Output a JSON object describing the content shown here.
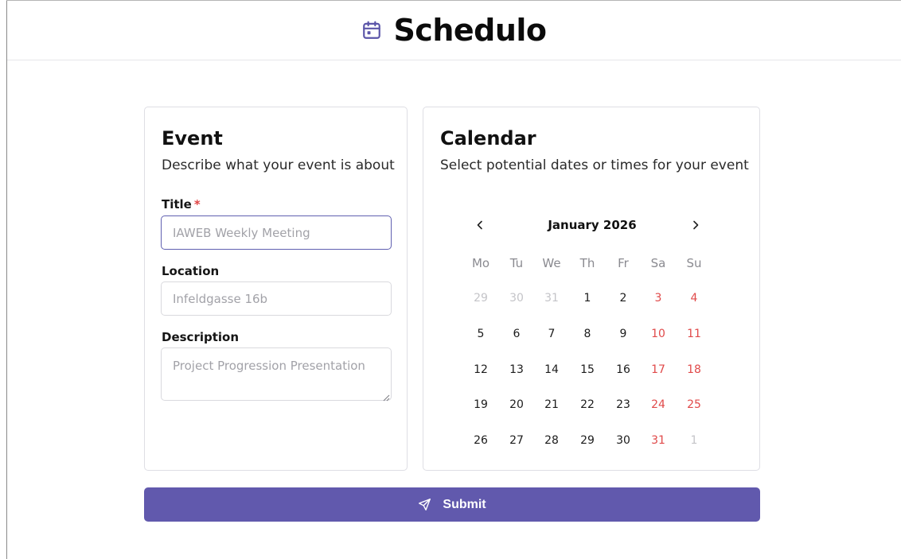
{
  "app": {
    "title": "Schedulo",
    "icon": "calendar-icon",
    "accent": "#6159ad"
  },
  "event": {
    "heading": "Event",
    "subtitle": "Describe what your event is about",
    "title_label": "Title",
    "required_mark": "*",
    "title_value": "",
    "title_placeholder": "IAWEB Weekly Meeting",
    "location_label": "Location",
    "location_value": "",
    "location_placeholder": "Infeldgasse 16b",
    "description_label": "Description",
    "description_value": "",
    "description_placeholder": "Project Progression Presentation"
  },
  "calendar": {
    "heading": "Calendar",
    "subtitle": "Select potential dates or times for your event",
    "month_label": "January 2026",
    "prev_icon": "chevron-left-icon",
    "next_icon": "chevron-right-icon",
    "weekdays": [
      "Mo",
      "Tu",
      "We",
      "Th",
      "Fr",
      "Sa",
      "Su"
    ],
    "weeks": [
      [
        "29",
        "30",
        "31",
        "1",
        "2",
        "3",
        "4"
      ],
      [
        "5",
        "6",
        "7",
        "8",
        "9",
        "10",
        "11"
      ],
      [
        "12",
        "13",
        "14",
        "15",
        "16",
        "17",
        "18"
      ],
      [
        "19",
        "20",
        "21",
        "22",
        "23",
        "24",
        "25"
      ],
      [
        "26",
        "27",
        "28",
        "29",
        "30",
        "31",
        "1"
      ]
    ],
    "outside_month": [
      [
        true,
        true,
        true,
        false,
        false,
        false,
        false
      ],
      [
        false,
        false,
        false,
        false,
        false,
        false,
        false
      ],
      [
        false,
        false,
        false,
        false,
        false,
        false,
        false
      ],
      [
        false,
        false,
        false,
        false,
        false,
        false,
        false
      ],
      [
        false,
        false,
        false,
        false,
        false,
        false,
        true
      ]
    ],
    "weekend_color": "#e04a4a"
  },
  "submit": {
    "label": "Submit",
    "icon": "send-icon"
  }
}
